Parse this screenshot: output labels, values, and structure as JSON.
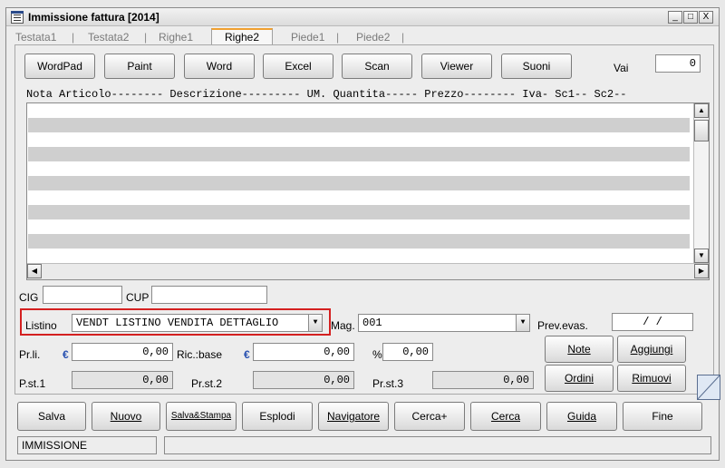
{
  "window": {
    "title": "Immissione fattura [2014]",
    "min_glyph": "_",
    "max_glyph": "□",
    "close_glyph": "X"
  },
  "tabs": [
    {
      "label": "Testata1"
    },
    {
      "label": "Testata2"
    },
    {
      "label": "Righe1"
    },
    {
      "label": "Righe2",
      "active": true
    },
    {
      "label": "Piede1"
    },
    {
      "label": "Piede2"
    }
  ],
  "tab_separator": "|",
  "toolbar": {
    "buttons": [
      "WordPad",
      "Paint",
      "Word",
      "Excel",
      "Scan",
      "Viewer",
      "Suoni"
    ],
    "vai_label": "Vai",
    "vai_value": "0"
  },
  "grid": {
    "header": "Nota Articolo-------- Descrizione--------- UM. Quantita----- Prezzo-------- Iva- Sc1-- Sc2--",
    "row_count": 6
  },
  "form": {
    "cig_label": "CIG",
    "cig_value": "",
    "cup_label": "CUP",
    "cup_value": "",
    "listino_label": "Listino",
    "listino_value": "VENDT  LISTINO VENDITA DETTAGLIO",
    "mag_label": "Mag.",
    "mag_value": "001",
    "prev_evas_label": "Prev.evas.",
    "prev_evas_value": "/ /",
    "prli_label": "Pr.li.",
    "prli_value": "0,00",
    "ric_base_label": "Ric.:base",
    "ric_base_value": "0,00",
    "pct_label": "%",
    "pct_value": "0,00",
    "prst1_label": "P.st.1",
    "prst1_value": "0,00",
    "prst2_label": "Pr.st.2",
    "prst2_value": "0,00",
    "prst3_label": "Pr.st.3",
    "prst3_value": "0,00",
    "currency_symbol": "€"
  },
  "actions": {
    "note": "Note",
    "aggiungi": "Aggiungi",
    "ordini": "Ordini",
    "rimuovi": "Rimuovi"
  },
  "bottom_buttons": [
    "Salva",
    "Nuovo",
    "Salva&Stampa",
    "Esplodi",
    "Navigatore",
    "Cerca+",
    "Cerca",
    "Guida",
    "Fine"
  ],
  "status": {
    "mode": "IMMISSIONE",
    "message": ""
  },
  "colors": {
    "highlight": "#d42020",
    "accent_tab": "#f0a030",
    "euro": "#2750b0"
  }
}
